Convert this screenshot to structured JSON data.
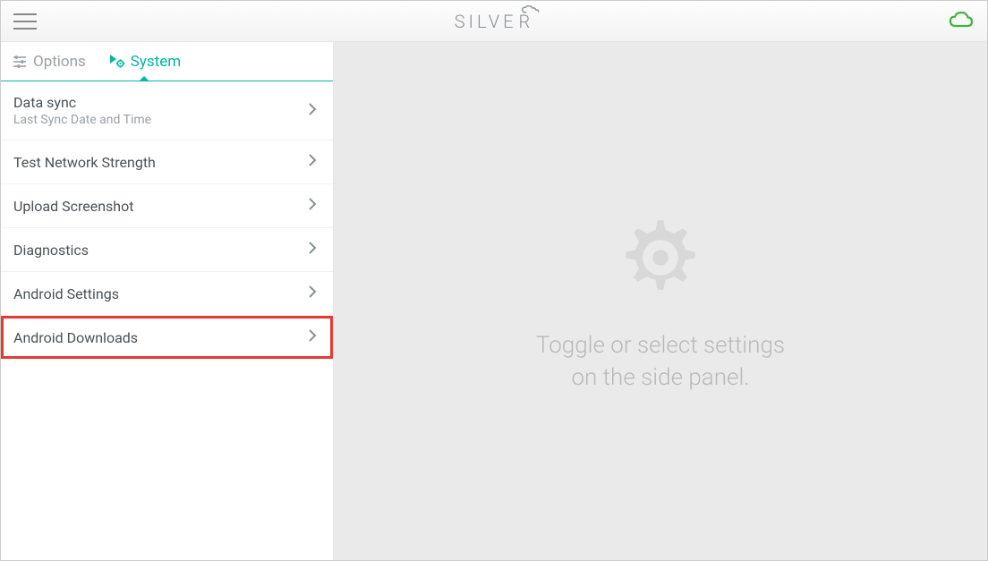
{
  "header": {
    "brand_text": "SILVER"
  },
  "tabs": {
    "options": {
      "label": "Options",
      "active": false
    },
    "system": {
      "label": "System",
      "active": true
    }
  },
  "sidebar_items": [
    {
      "title": "Data sync",
      "subtitle": "Last Sync Date and Time"
    },
    {
      "title": "Test Network Strength"
    },
    {
      "title": "Upload Screenshot"
    },
    {
      "title": "Diagnostics"
    },
    {
      "title": "Android Settings"
    },
    {
      "title": "Android Downloads",
      "highlighted": true
    }
  ],
  "main": {
    "placeholder_line1": "Toggle or select settings",
    "placeholder_line2": "on the side panel."
  }
}
